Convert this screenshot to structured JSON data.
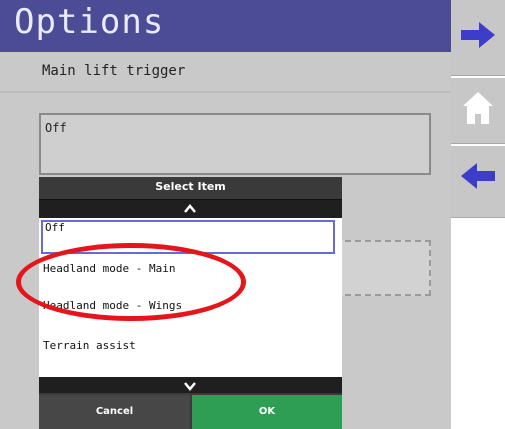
{
  "header": {
    "title": "Options"
  },
  "section": {
    "label": "Main lift trigger"
  },
  "field": {
    "value": "Off"
  },
  "dialog": {
    "title": "Select Item",
    "items": [
      "Off",
      "Headland mode - Main",
      "Headland mode - Wings",
      "Terrain assist"
    ],
    "selected_index": 0,
    "cancel_label": "Cancel",
    "ok_label": "OK"
  },
  "icons": {
    "nav_forward": "arrow-right-icon",
    "home": "home-icon",
    "nav_back": "arrow-left-icon",
    "scroll_up": "chevron-up-icon",
    "scroll_down": "chevron-down-icon"
  },
  "colors": {
    "header_bg": "#4b4b96",
    "arrow_blue": "#3d3dc9",
    "ok_green": "#2f9e55",
    "selection_border": "#6a6ad6",
    "annotation_red": "#e4161c"
  }
}
